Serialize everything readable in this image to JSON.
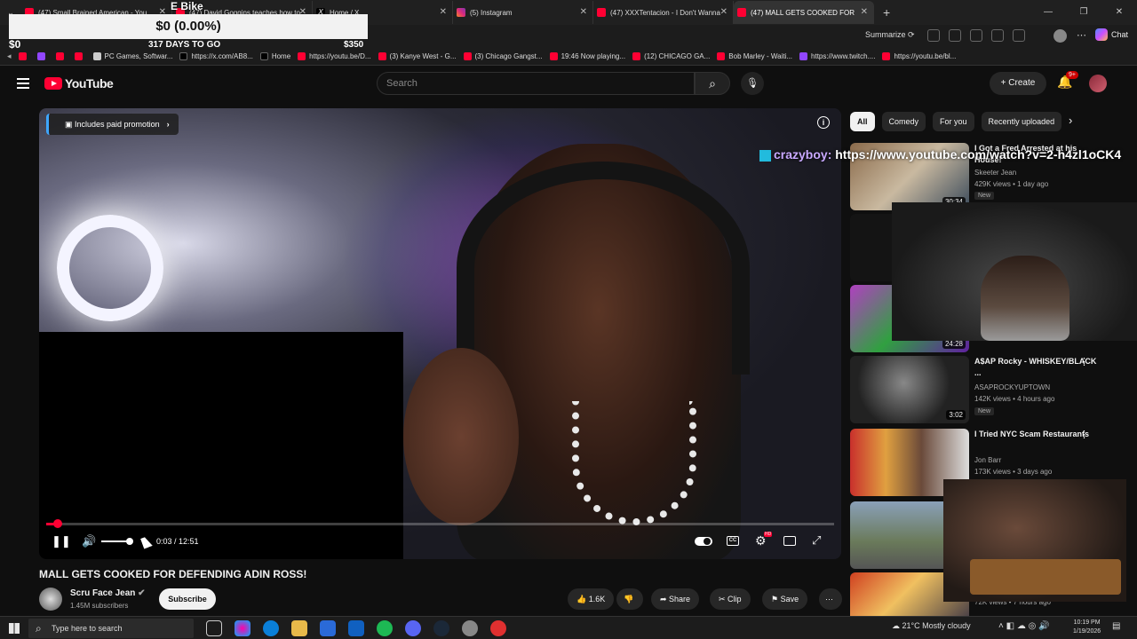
{
  "browser": {
    "tabs": [
      {
        "title": "(47) Small Brained American - You",
        "icon": "youtube-icon"
      },
      {
        "title": "(47) David Goggins teaches how to",
        "icon": "youtube-icon"
      },
      {
        "title": "Home / X",
        "icon": "x-icon"
      },
      {
        "title": "(5) Instagram",
        "icon": "instagram-icon"
      },
      {
        "title": "(47) XXXTentacion - I Don't Wanna",
        "icon": "youtube-icon"
      },
      {
        "title": "(47) MALL GETS COOKED FOR",
        "icon": "youtube-icon",
        "active": true
      }
    ],
    "summarize_label": "Summarize",
    "chat_label": "Chat",
    "bookmarks": [
      {
        "label": "",
        "icon": "youtube-icon"
      },
      {
        "label": "",
        "icon": "twitch-icon"
      },
      {
        "label": "",
        "icon": "youtube-icon"
      },
      {
        "label": "",
        "icon": "youtube-icon"
      },
      {
        "label": "PC Games, Softwar...",
        "icon": "pc-icon"
      },
      {
        "label": "https://x.com/AB8...",
        "icon": "x-icon"
      },
      {
        "label": "Home",
        "icon": "x-icon"
      },
      {
        "label": "https://youtu.be/D...",
        "icon": "youtube-icon"
      },
      {
        "label": "(3) Kanye West - G...",
        "icon": "youtube-icon"
      },
      {
        "label": "(3) Chicago Gangst...",
        "icon": "youtube-icon"
      },
      {
        "label": "19:46 Now playing...",
        "icon": "youtube-icon"
      },
      {
        "label": "(12) CHICAGO GA...",
        "icon": "youtube-icon"
      },
      {
        "label": "Bob Marley - Waiti...",
        "icon": "youtube-icon"
      },
      {
        "label": "https://www.twitch....",
        "icon": "twitch-icon"
      },
      {
        "label": "https://youtu.be/bl...",
        "icon": "youtube-icon"
      }
    ]
  },
  "stream_overlay": {
    "goal_label": "E Bike",
    "goal_amount": "$0 (0.00%)",
    "current": "$0",
    "days_left": "317 DAYS TO GO",
    "target": "$350",
    "chat_user": "crazyboy:",
    "chat_message": "https://www.youtube.com/watch?v=2-h4zl1oCK4"
  },
  "youtube": {
    "logo_text": "YouTube",
    "search_placeholder": "Search",
    "create_label": "Create",
    "notification_count": "9+"
  },
  "player": {
    "promo_label": "Includes paid promotion",
    "current_time": "0:03",
    "duration": "12:51",
    "time_display": "0:03 / 12:51",
    "progress_fraction": 0.004
  },
  "video": {
    "title": "MALL GETS COOKED FOR DEFENDING ADIN ROSS!",
    "channel": "Scru Face Jean",
    "subscribers": "1.45M subscribers",
    "subscribe_label": "Subscribe",
    "likes": "1.6K",
    "share_label": "Share",
    "clip_label": "Clip",
    "save_label": "Save"
  },
  "sidebar": {
    "chips": [
      "All",
      "Comedy",
      "For you",
      "Recently uploaded"
    ],
    "recommendations": [
      {
        "title": "I Got a Fred Arrested at his House!",
        "channel": "Skeeter Jean",
        "meta": "429K views • 1 day ago",
        "badge": "New",
        "duration": "30:34"
      },
      {
        "title": "",
        "channel": "",
        "meta": "",
        "badge": "",
        "duration": ""
      },
      {
        "title": "",
        "channel": "",
        "meta": "",
        "badge": "",
        "duration": "24:28"
      },
      {
        "title": "A$AP Rocky - WHISKEY/BLACK ...",
        "channel": "ASAPROCKYUPTOWN",
        "meta": "142K views • 4 hours ago",
        "badge": "New",
        "duration": "3:02"
      },
      {
        "title": "I Tried NYC Scam Restaurants",
        "channel": "Jon Barr",
        "meta": "173K views • 3 days ago",
        "badge": "",
        "duration": ""
      },
      {
        "title": "",
        "channel": "",
        "meta": "",
        "badge": "",
        "duration": ""
      },
      {
        "title": "",
        "channel": "",
        "meta": "72K views • 7 hours ago",
        "badge": "",
        "duration": ""
      }
    ]
  },
  "taskbar": {
    "search_placeholder": "Type here to search",
    "weather": "21°C  Mostly cloudy",
    "time": "10:19 PM",
    "date": "1/19/2026"
  }
}
